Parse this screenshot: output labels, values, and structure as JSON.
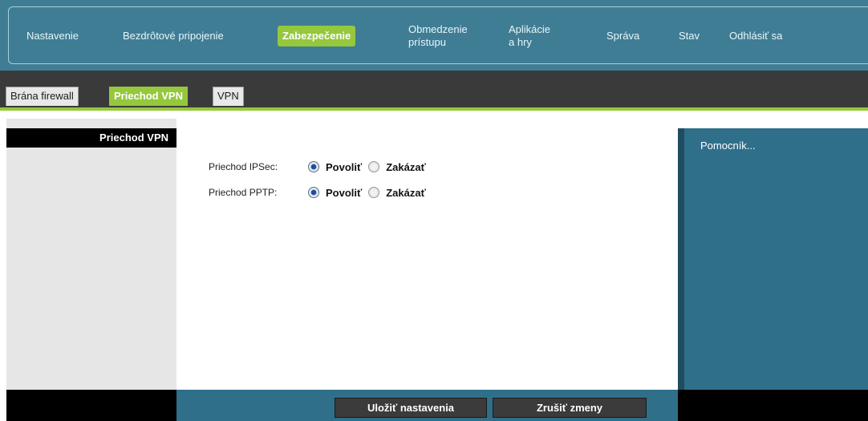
{
  "nav": {
    "items": [
      {
        "label": "Nastavenie",
        "active": false
      },
      {
        "label": "Bezdrôtové pripojenie",
        "active": false
      },
      {
        "label": "Zabezpečenie",
        "active": true
      },
      {
        "label": "Obmedzenie prístupu",
        "active": false
      },
      {
        "label": "Aplikácie a hry",
        "active": false
      },
      {
        "label": "Správa",
        "active": false
      },
      {
        "label": "Stav",
        "active": false
      },
      {
        "label": "Odhlásiť sa",
        "active": false
      }
    ]
  },
  "subtabs": [
    {
      "label": "Brána firewall",
      "active": false
    },
    {
      "label": "Priechod VPN",
      "active": true
    },
    {
      "label": "VPN",
      "active": false
    }
  ],
  "sidebar": {
    "title": "Priechod VPN"
  },
  "form": {
    "rows": [
      {
        "label": "Priechod IPSec:",
        "enable": "Povoliť",
        "disable": "Zakázať",
        "selected": "enable"
      },
      {
        "label": "Priechod PPTP:",
        "enable": "Povoliť",
        "disable": "Zakázať",
        "selected": "enable"
      }
    ]
  },
  "help": {
    "label": "Pomocník..."
  },
  "buttons": {
    "save": "Uložiť nastavenia",
    "cancel": "Zrušiť zmeny"
  },
  "colors": {
    "accent_green": "#95c83c",
    "nav_teal": "#3f7d94",
    "help_teal": "#2f6f89"
  }
}
